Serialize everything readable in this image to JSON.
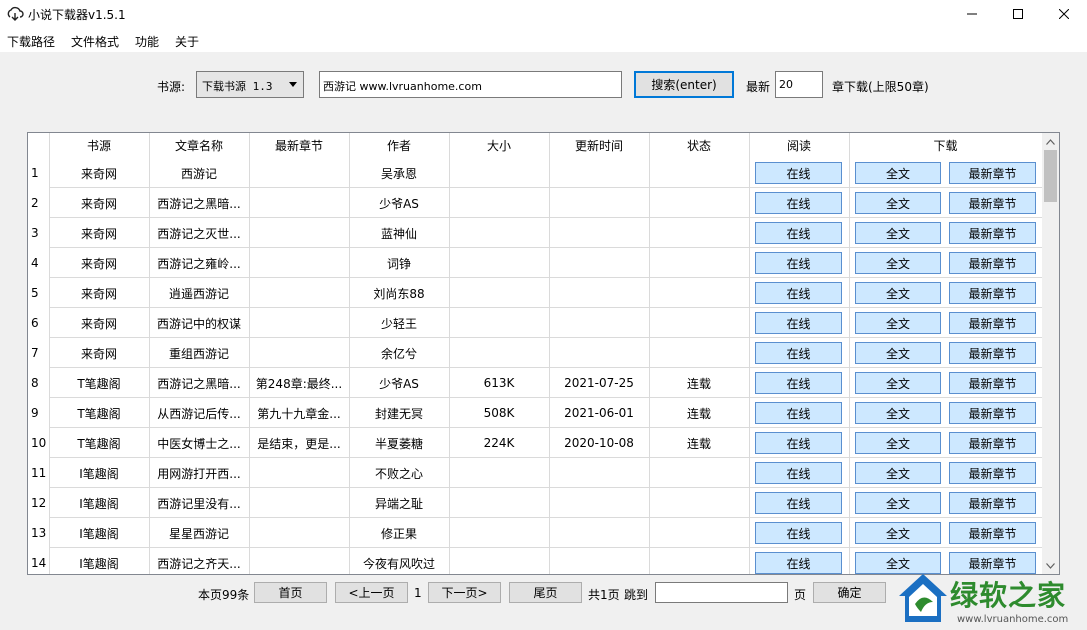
{
  "window": {
    "title": "小说下载器v1.5.1"
  },
  "menu": [
    "下载路径",
    "文件格式",
    "功能",
    "关于"
  ],
  "search": {
    "source_label": "书源:",
    "source_selected": "下载书源 1.3",
    "query_value": "西游记 www.lvruanhome.com",
    "search_button": "搜索(enter)",
    "latest_label": "最新",
    "latest_value": "20",
    "latest_suffix": "章下载(上限50章)"
  },
  "table": {
    "headers": [
      "书源",
      "文章名称",
      "最新章节",
      "作者",
      "大小",
      "更新时间",
      "状态",
      "阅读",
      "下载"
    ],
    "read_button": "在线",
    "full_button": "全文",
    "latest_button": "最新章节",
    "rows": [
      {
        "n": "1",
        "source": "来奇网",
        "name": "西游记",
        "chapter": "",
        "author": "吴承恩",
        "size": "",
        "date": "",
        "status": ""
      },
      {
        "n": "2",
        "source": "来奇网",
        "name": "西游记之黑暗...",
        "chapter": "",
        "author": "少爷AS",
        "size": "",
        "date": "",
        "status": ""
      },
      {
        "n": "3",
        "source": "来奇网",
        "name": "西游记之灭世...",
        "chapter": "",
        "author": "蓝神仙",
        "size": "",
        "date": "",
        "status": ""
      },
      {
        "n": "4",
        "source": "来奇网",
        "name": "西游记之雍岭...",
        "chapter": "",
        "author": "词铮",
        "size": "",
        "date": "",
        "status": ""
      },
      {
        "n": "5",
        "source": "来奇网",
        "name": "逍遥西游记",
        "chapter": "",
        "author": "刘尚东88",
        "size": "",
        "date": "",
        "status": ""
      },
      {
        "n": "6",
        "source": "来奇网",
        "name": "西游记中的权谋",
        "chapter": "",
        "author": "少轻王",
        "size": "",
        "date": "",
        "status": ""
      },
      {
        "n": "7",
        "source": "来奇网",
        "name": "重组西游记",
        "chapter": "",
        "author": "余亿兮",
        "size": "",
        "date": "",
        "status": ""
      },
      {
        "n": "8",
        "source": "T笔趣阁",
        "name": "西游记之黑暗...",
        "chapter": "第248章:最终...",
        "author": "少爷AS",
        "size": "613K",
        "date": "2021-07-25",
        "status": "连载"
      },
      {
        "n": "9",
        "source": "T笔趣阁",
        "name": "从西游记后传...",
        "chapter": "第九十九章金...",
        "author": "封建无冥",
        "size": "508K",
        "date": "2021-06-01",
        "status": "连载"
      },
      {
        "n": "10",
        "source": "T笔趣阁",
        "name": "中医女博士之...",
        "chapter": "是结束，更是...",
        "author": "半夏萎糖",
        "size": "224K",
        "date": "2020-10-08",
        "status": "连载"
      },
      {
        "n": "11",
        "source": "I笔趣阁",
        "name": "用网游打开西...",
        "chapter": "",
        "author": "不败之心",
        "size": "",
        "date": "",
        "status": ""
      },
      {
        "n": "12",
        "source": "I笔趣阁",
        "name": "西游记里没有...",
        "chapter": "",
        "author": "异端之耻",
        "size": "",
        "date": "",
        "status": ""
      },
      {
        "n": "13",
        "source": "I笔趣阁",
        "name": "星星西游记",
        "chapter": "",
        "author": "修正果",
        "size": "",
        "date": "",
        "status": ""
      },
      {
        "n": "14",
        "source": "I笔趣阁",
        "name": "西游记之齐天...",
        "chapter": "",
        "author": "今夜有风吹过",
        "size": "",
        "date": "",
        "status": ""
      }
    ]
  },
  "pager": {
    "count_text": "本页99条",
    "first": "首页",
    "prev": "<上一页",
    "current": "1",
    "next": "下一页>",
    "last": "尾页",
    "total_text": "共1页",
    "jump_label": "跳到",
    "jump_value": "",
    "page_unit": "页",
    "confirm": "确定"
  },
  "watermark": {
    "brand": "绿软之家",
    "url": "www.lvruanhome.com"
  },
  "colors": {
    "grid_button_bg": "#cde8ff",
    "grid_button_border": "#5a8fcf",
    "watermark_green": "#2e8b2e",
    "watermark_blue": "#1b6fc2"
  }
}
